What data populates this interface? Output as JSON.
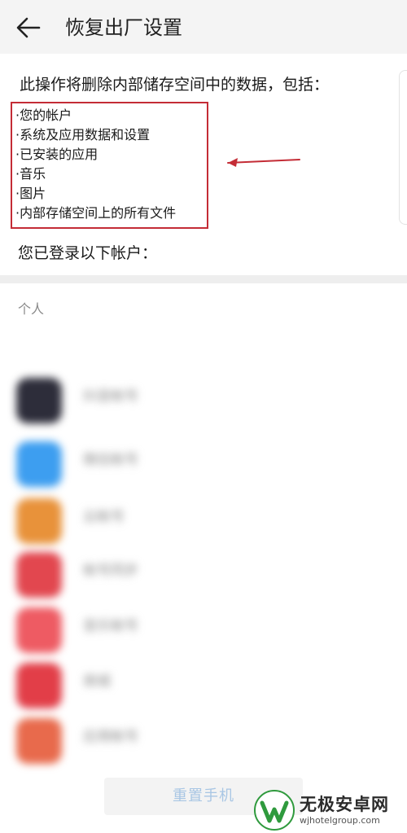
{
  "header": {
    "title": "恢复出厂设置",
    "back_icon": "arrow-left-icon"
  },
  "content": {
    "intro": "此操作将删除内部储存空间中的数据，包括：",
    "items": [
      "·您的帐户",
      "·系统及应用数据和设置",
      "·已安装的应用",
      "·音乐",
      "·图片",
      "·内部存储空间上的所有文件"
    ],
    "accounts_label": "您已登录以下帐户：",
    "highlight_color": "#c42c36"
  },
  "section": {
    "label": "个人"
  },
  "accounts": [
    {
      "name": "抖音帐号",
      "color": "#2d2d3a"
    },
    {
      "name": "微信帐号",
      "color": "#3d9ef0"
    },
    {
      "name": "云帐号",
      "color": "#e8923a"
    },
    {
      "name": "帐号同步",
      "color": "#e2474f"
    },
    {
      "name": "音乐帐号",
      "color": "#ee5b63"
    },
    {
      "name": "商城",
      "color": "#e23e48"
    },
    {
      "name": "应用帐号",
      "color": "#e86a4c"
    }
  ],
  "footer": {
    "reset_button": "重置手机"
  },
  "watermark": {
    "name": "无极安卓网",
    "url": "wjhotelgroup.com",
    "logo_color": "#2f9a3d"
  }
}
